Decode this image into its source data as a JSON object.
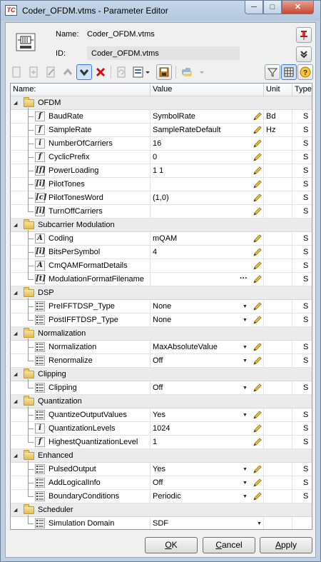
{
  "window": {
    "title": "Coder_OFDM.vtms - Parameter Editor",
    "app_icon": "TC",
    "minimize": "─",
    "maximize": "□",
    "close": "✕"
  },
  "header": {
    "name_label": "Name:",
    "name_value": "Coder_OFDM.vtms",
    "id_label": "ID:",
    "id_value": "Coder_OFDM.vtms"
  },
  "grid": {
    "columns": {
      "name": "Name:",
      "value": "Value",
      "unit": "Unit",
      "type": "Type"
    },
    "groups": [
      {
        "name": "OFDM",
        "params": [
          {
            "icon": "f",
            "name": "BaudRate",
            "value": "SymbolRate",
            "unit": "Bd",
            "type": "S"
          },
          {
            "icon": "f",
            "name": "SampleRate",
            "value": "SampleRateDefault",
            "unit": "Hz",
            "type": "S"
          },
          {
            "icon": "i",
            "name": "NumberOfCarriers",
            "value": "16",
            "unit": "",
            "type": "S"
          },
          {
            "icon": "f",
            "name": "CyclicPrefix",
            "value": "0",
            "unit": "",
            "type": "S"
          },
          {
            "icon": "[f]",
            "name": "PowerLoading",
            "value": "1 1",
            "unit": "",
            "type": "S"
          },
          {
            "icon": "[i]",
            "name": "PilotTones",
            "value": "",
            "unit": "",
            "type": "S"
          },
          {
            "icon": "[c]",
            "name": "PilotTonesWord",
            "value": "(1,0)",
            "unit": "",
            "type": "S"
          },
          {
            "icon": "[i]",
            "name": "TurnOffCarriers",
            "value": "",
            "unit": "",
            "type": "S"
          }
        ]
      },
      {
        "name": "Subcarrier Modulation",
        "params": [
          {
            "icon": "A",
            "name": "Coding",
            "value": "mQAM",
            "unit": "",
            "type": "S"
          },
          {
            "icon": "[i]",
            "name": "BitsPerSymbol",
            "value": "4",
            "unit": "",
            "type": "S"
          },
          {
            "icon": "A",
            "name": "CmQAMFormatDetails",
            "value": "",
            "unit": "",
            "type": "S"
          },
          {
            "icon": "[t]",
            "name": "ModulationFormatFilename",
            "value": "",
            "unit": "",
            "type": "S",
            "ellipsis": "···"
          }
        ]
      },
      {
        "name": "DSP",
        "params": [
          {
            "icon": "sel",
            "name": "PreIFFTDSP_Type",
            "value": "None",
            "unit": "",
            "type": "S",
            "dropdown": "▼"
          },
          {
            "icon": "sel",
            "name": "PostIFFTDSP_Type",
            "value": "None",
            "unit": "",
            "type": "S",
            "dropdown": "▼"
          }
        ]
      },
      {
        "name": "Normalization",
        "params": [
          {
            "icon": "sel",
            "name": "Normalization",
            "value": "MaxAbsoluteValue",
            "unit": "",
            "type": "S",
            "dropdown": "▼"
          },
          {
            "icon": "sel",
            "name": "Renormalize",
            "value": "Off",
            "unit": "",
            "type": "S",
            "dropdown": "▼"
          }
        ]
      },
      {
        "name": "Clipping",
        "params": [
          {
            "icon": "sel",
            "name": "Clipping",
            "value": "Off",
            "unit": "",
            "type": "S",
            "dropdown": "▼"
          }
        ]
      },
      {
        "name": "Quantization",
        "params": [
          {
            "icon": "sel",
            "name": "QuantizeOutputValues",
            "value": "Yes",
            "unit": "",
            "type": "S",
            "dropdown": "▼"
          },
          {
            "icon": "i",
            "name": "QuantizationLevels",
            "value": "1024",
            "unit": "",
            "type": "S"
          },
          {
            "icon": "f",
            "name": "HighestQuantizationLevel",
            "value": "1",
            "unit": "",
            "type": "S"
          }
        ]
      },
      {
        "name": "Enhanced",
        "params": [
          {
            "icon": "sel",
            "name": "PulsedOutput",
            "value": "Yes",
            "unit": "",
            "type": "S",
            "dropdown": "▼"
          },
          {
            "icon": "sel",
            "name": "AddLogicalInfo",
            "value": "Off",
            "unit": "",
            "type": "S",
            "dropdown": "▼"
          },
          {
            "icon": "sel",
            "name": "BoundaryConditions",
            "value": "Periodic",
            "unit": "",
            "type": "S",
            "dropdown": "▼"
          }
        ]
      },
      {
        "name": "Scheduler",
        "params": [
          {
            "icon": "sel",
            "name": "Simulation Domain",
            "value": "SDF",
            "unit": "",
            "type": "",
            "dropdown": "▼",
            "no_edit": true
          }
        ]
      }
    ]
  },
  "buttons": {
    "ok": {
      "mnemonic": "O",
      "rest": "K"
    },
    "cancel": {
      "mnemonic": "C",
      "rest": "ancel"
    },
    "apply": {
      "mnemonic": "A",
      "rest": "pply"
    }
  }
}
